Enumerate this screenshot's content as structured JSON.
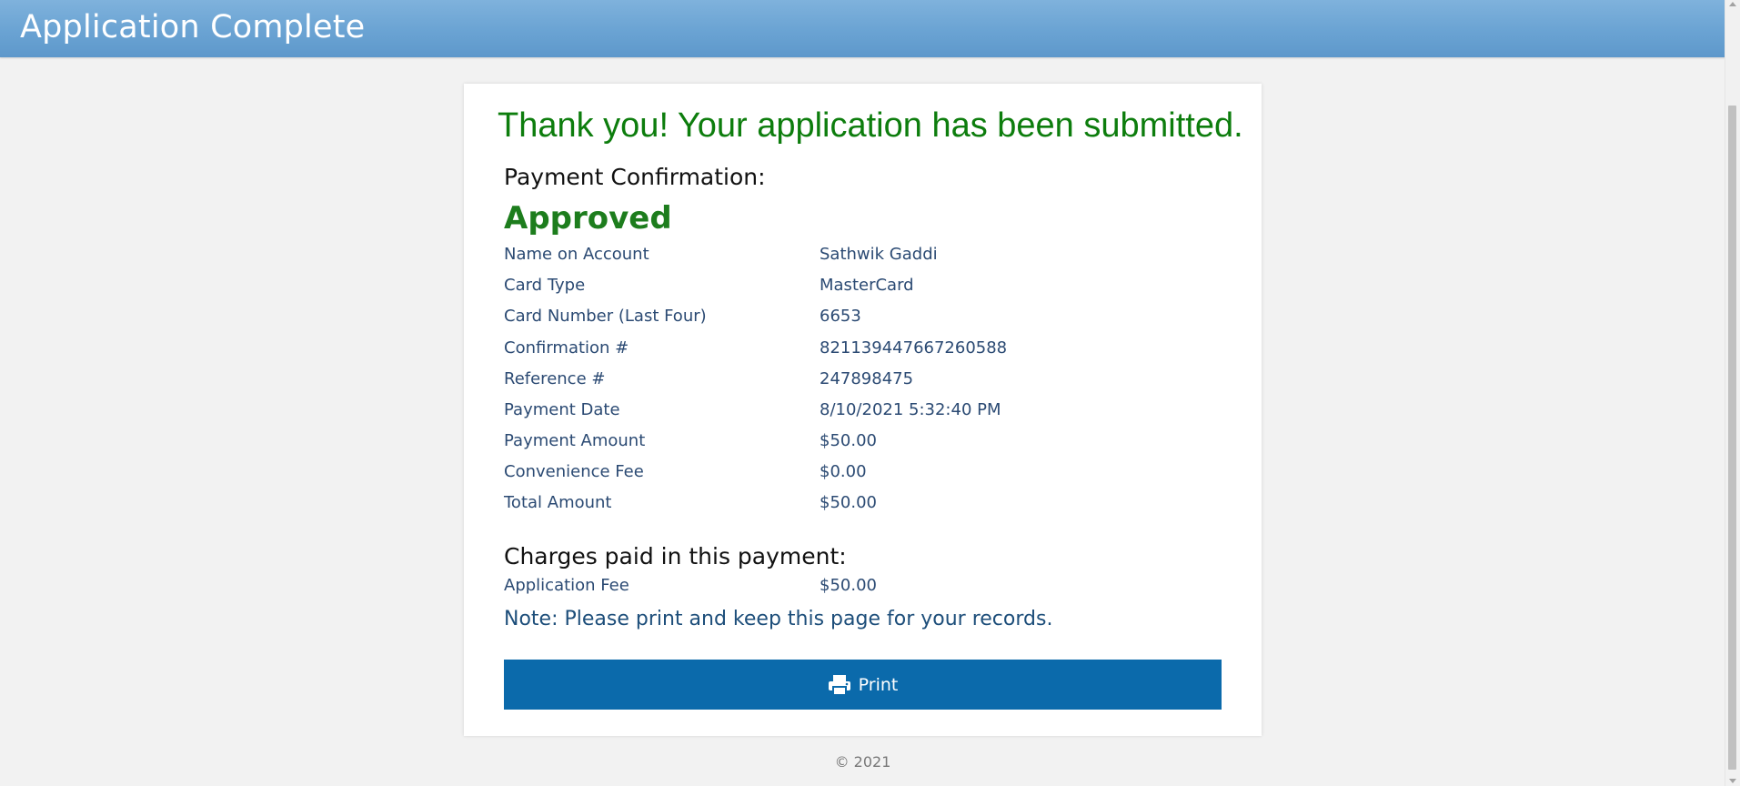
{
  "header": {
    "title": "Application Complete"
  },
  "confirmation": {
    "headline": "Thank you! Your application has been submitted.",
    "payment_section_label": "Payment Confirmation:",
    "status": "Approved",
    "details": [
      {
        "label": "Name on Account",
        "value": "Sathwik Gaddi"
      },
      {
        "label": "Card Type",
        "value": "MasterCard"
      },
      {
        "label": "Card Number (Last Four)",
        "value": "6653"
      },
      {
        "label": "Confirmation #",
        "value": "821139447667260588"
      },
      {
        "label": "Reference #",
        "value": "247898475"
      },
      {
        "label": "Payment Date",
        "value": "8/10/2021 5:32:40 PM"
      },
      {
        "label": "Payment Amount",
        "value": "$50.00"
      },
      {
        "label": "Convenience Fee",
        "value": "$0.00"
      },
      {
        "label": "Total Amount",
        "value": "$50.00"
      }
    ],
    "charges_section_label": "Charges paid in this payment:",
    "charges": [
      {
        "label": "Application Fee",
        "value": "$50.00"
      }
    ],
    "note": "Note: Please print and keep this page for your records.",
    "print_label": "Print"
  },
  "footer": {
    "copyright": "© 2021"
  },
  "colors": {
    "header_bg": "#6aa3d3",
    "success_green": "#0d7d0d",
    "button_blue": "#0b6aab",
    "detail_text": "#2b4a73"
  },
  "icons": {
    "print": "print-icon"
  }
}
